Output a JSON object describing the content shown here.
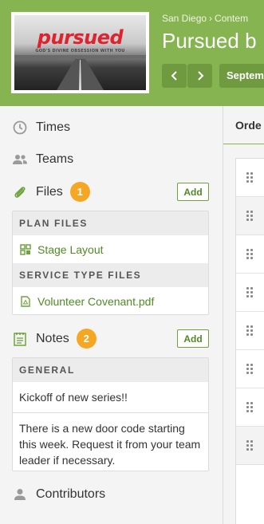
{
  "header": {
    "thumbnail": {
      "logo_word": "pursued",
      "logo_tagline": "GOD'S DIVINE OBSESSION WITH YOU",
      "brand_color": "#e0212e"
    },
    "breadcrumbs": [
      "San Diego",
      "Contem"
    ],
    "title": "Pursued b",
    "prev_icon": "chevron-left-icon",
    "next_icon": "chevron-right-icon",
    "date_label": "Septem",
    "bg_color": "#85b451"
  },
  "sidebar": {
    "times": {
      "label": "Times",
      "icon": "clock-icon"
    },
    "teams": {
      "label": "Teams",
      "icon": "people-icon"
    },
    "files": {
      "label": "Files",
      "icon": "paperclip-icon",
      "count": "1",
      "add_label": "Add",
      "sections": [
        {
          "header": "PLAN FILES",
          "items": [
            {
              "name": "Stage Layout",
              "icon": "layout-icon"
            }
          ]
        },
        {
          "header": "SERVICE TYPE FILES",
          "items": [
            {
              "name": "Volunteer Covenant.pdf",
              "icon": "pdf-file-icon"
            }
          ]
        }
      ]
    },
    "notes": {
      "label": "Notes",
      "icon": "notepad-icon",
      "count": "2",
      "add_label": "Add",
      "category": "GENERAL",
      "items": [
        "Kickoff of new series!!",
        "There is a new door code starting this week. Request it from your team leader if necessary."
      ]
    },
    "contributors": {
      "label": "Contributors",
      "icon": "person-icon"
    }
  },
  "main": {
    "tab_label": "Orde",
    "rows": 8
  }
}
